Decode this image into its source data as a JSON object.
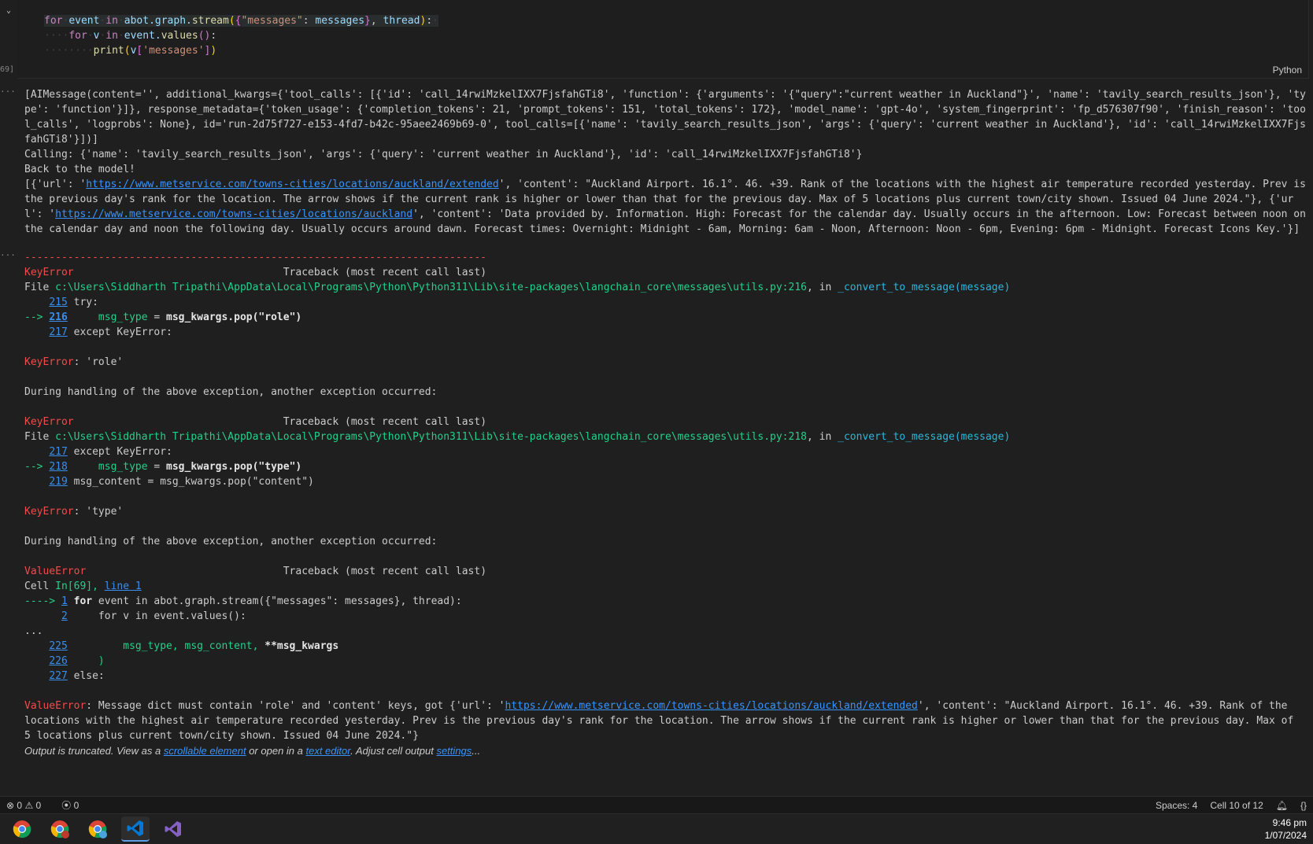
{
  "cell": {
    "exec_count_label": "69]",
    "language": "Python",
    "code": {
      "line1": {
        "kw1": "for",
        "v1": "event",
        "kw2": "in",
        "obj": "abot.graph.",
        "fn": "stream",
        "p1": "(",
        "b1": "{",
        "s1": "\"messages\"",
        "c1": ": ",
        "v2": "messages",
        "b2": "}",
        "c2": ", ",
        "v3": "thread",
        "p2": ")",
        "end": ":"
      },
      "line2": {
        "kw1": "for",
        "v1": "v",
        "kw2": "in",
        "obj": "event.",
        "fn": "values",
        "p": "()",
        "end": ":"
      },
      "line3": {
        "fn": "print",
        "p1": "(",
        "v": "v",
        "b1": "[",
        "s": "'messages'",
        "b2": "]",
        "p2": ")"
      }
    }
  },
  "output": {
    "block1": "[AIMessage(content='', additional_kwargs={'tool_calls': [{'id': 'call_14rwiMzkelIXX7FjsfahGTi8', 'function': {'arguments': '{\"query\":\"current weather in Auckland\"}', 'name': 'tavily_search_results_json'}, 'type': 'function'}]}, response_metadata={'token_usage': {'completion_tokens': 21, 'prompt_tokens': 151, 'total_tokens': 172}, 'model_name': 'gpt-4o', 'system_fingerprint': 'fp_d576307f90', 'finish_reason': 'tool_calls', 'logprobs': None}, id='run-2d75f727-e153-4fd7-b42c-95aee2469b69-0', tool_calls=[{'name': 'tavily_search_results_json', 'args': {'query': 'current weather in Auckland'}, 'id': 'call_14rwiMzkelIXX7FjsfahGTi8'}])]",
    "calling": "Calling: {'name': 'tavily_search_results_json', 'args': {'query': 'current weather in Auckland'}, 'id': 'call_14rwiMzkelIXX7FjsfahGTi8'}",
    "back": "Back to the model!",
    "result_prefix": "[{'url': '",
    "result_url1": "https://www.metservice.com/towns-cities/locations/auckland/extended",
    "result_mid1": "', 'content': \"Auckland Airport. 16.1°. 46. +39. Rank of the locations with the highest air temperature recorded yesterday. Prev is the previous day's rank for the location. The arrow shows if the current rank is higher or lower than that for the previous day. Max of 5 locations plus current town/city shown. Issued 04 June 2024.\"}, {'url': '",
    "result_url2": "https://www.metservice.com/towns-cities/locations/auckland",
    "result_mid2": "', 'content': 'Data provided by. Information. High: Forecast for the calendar day. Usually occurs in the afternoon. Low: Forecast between noon on the calendar day and noon the following day. Usually occurs around dawn. Forecast times: Overnight: Midnight - 6am, Morning: 6am - Noon, Afternoon: Noon - 6pm, Evening: 6pm - Midnight. Forecast Icons Key.'}]"
  },
  "error": {
    "separator": "---------------------------------------------------------------------------",
    "keyerror": "KeyError",
    "valueerror": "ValueError",
    "traceback": "Traceback (most recent call last)",
    "file_label": "File ",
    "path1": "c:\\Users\\Siddharth Tripathi\\AppData\\Local\\Programs\\Python\\Python311\\Lib\\site-packages\\langchain_core\\messages\\utils.py:216",
    "path2": "c:\\Users\\Siddharth Tripathi\\AppData\\Local\\Programs\\Python\\Python311\\Lib\\site-packages\\langchain_core\\messages\\utils.py:218",
    "in_label": ", in ",
    "func": "_convert_to_message(message)",
    "tb1": [
      {
        "arrow": "    ",
        "num": "215",
        "code": " try:"
      },
      {
        "arrow": "--> ",
        "num": "216",
        "code": "     msg_type = msg_kwargs.pop(\"role\")"
      },
      {
        "arrow": "    ",
        "num": "217",
        "code": " except KeyError:"
      }
    ],
    "keyerror_role": ": 'role'",
    "during": "During handling of the above exception, another exception occurred:",
    "tb2": [
      {
        "arrow": "    ",
        "num": "217",
        "code": " except KeyError:"
      },
      {
        "arrow": "--> ",
        "num": "218",
        "code": "     msg_type = msg_kwargs.pop(\"type\")"
      },
      {
        "arrow": "    ",
        "num": "219",
        "code": " msg_content = msg_kwargs.pop(\"content\")"
      }
    ],
    "keyerror_type": ": 'type'",
    "cell_label": "Cell ",
    "cell_in": "In[69], ",
    "cell_line": "line 1",
    "tb3_1": {
      "arrow": "----> ",
      "num": "1",
      "code": " for event in abot.graph.stream({\"messages\": messages}, thread):"
    },
    "tb3_2": {
      "arrow": "      ",
      "num": "2",
      "code": "     for v in event.values():"
    },
    "ellipsis": "...",
    "tb4": [
      {
        "num": "225",
        "code": "         msg_type, msg_content, **msg_kwargs"
      },
      {
        "num": "226",
        "code": "     )"
      },
      {
        "num": "227",
        "code": " else:"
      }
    ],
    "final_prefix": ": Message dict must contain 'role' and 'content' keys, got {'url': '",
    "final_url": "https://www.metservice.com/towns-cities/locations/auckland/extended",
    "final_rest": "', 'content': \"Auckland Airport. 16.1°. 46. +39. Rank of the locations with the highest air temperature recorded yesterday. Prev is the previous day's rank for the location. The arrow shows if the current rank is higher or lower than that for the previous day. Max of 5 locations plus current town/city shown. Issued 04 June 2024.\"}",
    "truncated_1": "Output is truncated. View as a ",
    "truncated_link1": "scrollable element",
    "truncated_2": " or open in a ",
    "truncated_link2": "text editor",
    "truncated_3": ". Adjust cell output ",
    "truncated_link3": "settings",
    "truncated_4": "..."
  },
  "statusbar": {
    "errors": "0",
    "warnings": "0",
    "ports": "0",
    "spaces": "Spaces: 4",
    "cell": "Cell 10 of 12"
  },
  "taskbar": {
    "time": "9:46 pm",
    "date": "1/07/2024",
    "apps": [
      "chrome-icon",
      "chrome-profile-icon",
      "chrome-profile-2-icon",
      "vscode-icon",
      "visual-studio-icon"
    ]
  }
}
